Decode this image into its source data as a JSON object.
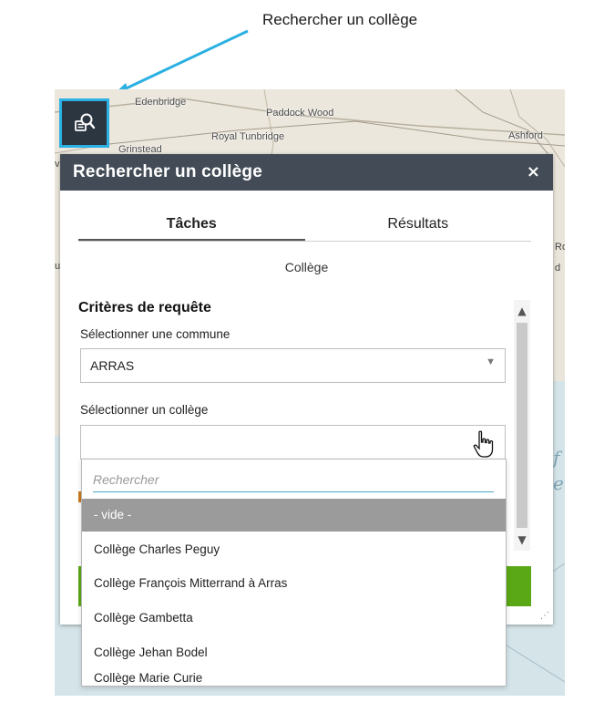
{
  "annotation": {
    "text": "Rechercher un collège"
  },
  "map": {
    "towns": [
      "Edenbridge",
      "Paddock Wood",
      "Royal Tunbridge",
      "Ashford",
      "Grinstead"
    ],
    "edge_labels": [
      "Ro",
      "d",
      "u",
      "v",
      "f",
      "e"
    ]
  },
  "tool": {
    "icon": "search-icon"
  },
  "panel": {
    "title": "Rechercher un collège",
    "close": "×",
    "tabs": [
      {
        "label": "Tâches",
        "active": true
      },
      {
        "label": "Résultats",
        "active": false
      }
    ],
    "section": "Collège",
    "criteria_title": "Critères de requête",
    "commune": {
      "label": "Sélectionner une commune",
      "value": "ARRAS"
    },
    "college": {
      "label": "Sélectionner un collège",
      "value": ""
    }
  },
  "dropdown": {
    "placeholder": "Rechercher",
    "options": [
      {
        "label": "- vide -",
        "selected": true
      },
      {
        "label": "Collège Charles Peguy",
        "selected": false
      },
      {
        "label": "Collège François Mitterrand à Arras",
        "selected": false
      },
      {
        "label": "Collège Gambetta",
        "selected": false
      },
      {
        "label": "Collège Jehan Bodel",
        "selected": false
      },
      {
        "label": "Collège Marie Curie",
        "selected": false
      }
    ]
  },
  "colors": {
    "header": "#434c56",
    "accent_blue": "#2ab0e2",
    "button_green": "#5aa816",
    "selected_option": "#9b9b9b"
  }
}
